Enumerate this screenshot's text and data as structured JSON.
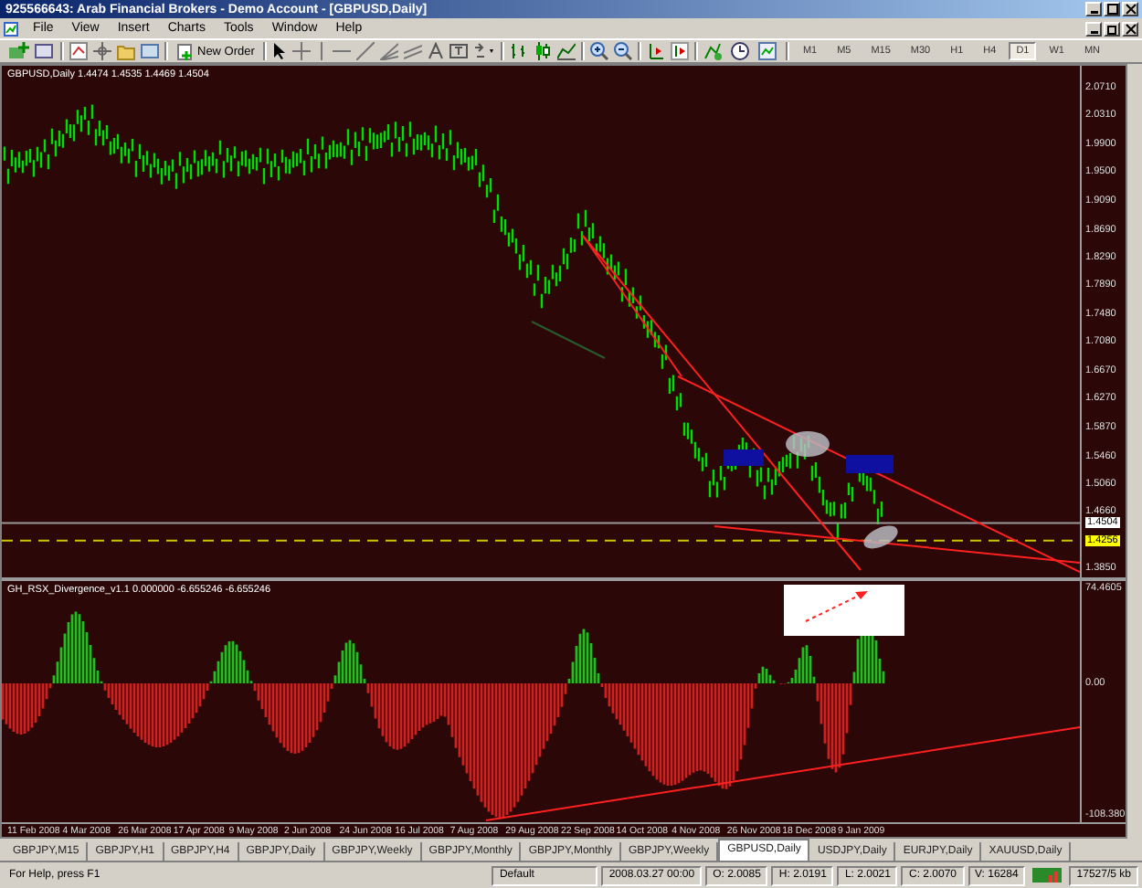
{
  "window": {
    "title": "925566643: Arab Financial Brokers - Demo Account - [GBPUSD,Daily]"
  },
  "menu": [
    "File",
    "View",
    "Insert",
    "Charts",
    "Tools",
    "Window",
    "Help"
  ],
  "toolbar": {
    "new_order": "New Order",
    "timeframes": [
      {
        "label": "M1",
        "selected": false
      },
      {
        "label": "M5",
        "selected": false
      },
      {
        "label": "M15",
        "selected": false
      },
      {
        "label": "M30",
        "selected": false
      },
      {
        "label": "H1",
        "selected": false
      },
      {
        "label": "H4",
        "selected": false
      },
      {
        "label": "D1",
        "selected": true
      },
      {
        "label": "W1",
        "selected": false
      },
      {
        "label": "MN",
        "selected": false
      }
    ]
  },
  "chart": {
    "header": "GBPUSD,Daily  1.4474 1.4535 1.4469 1.4504",
    "price_axis": [
      "2.0710",
      "2.0310",
      "1.9900",
      "1.9500",
      "1.9090",
      "1.8690",
      "1.8290",
      "1.7890",
      "1.7480",
      "1.7080",
      "1.6670",
      "1.6270",
      "1.5870",
      "1.5460",
      "1.5060",
      "1.4660",
      "1.3850"
    ],
    "bid_label": "1.4504",
    "ask_label": "1.4256"
  },
  "indicator": {
    "header": "GH_RSX_Divergence_v1.1 0.000000 -6.655246 -6.655246",
    "axis": [
      "74.4605",
      "0.00",
      "-108.380"
    ]
  },
  "time_axis": [
    "11 Feb 2008",
    "4 Mar 2008",
    "26 Mar 2008",
    "17 Apr 2008",
    "9 May 2008",
    "2 Jun 2008",
    "24 Jun 2008",
    "16 Jul 2008",
    "7 Aug 2008",
    "29 Aug 2008",
    "22 Sep 2008",
    "14 Oct 2008",
    "4 Nov 2008",
    "26 Nov 2008",
    "18 Dec 2008",
    "9 Jan 2009"
  ],
  "tabs": [
    {
      "label": "GBPJPY,M15",
      "selected": false
    },
    {
      "label": "GBPJPY,H1",
      "selected": false
    },
    {
      "label": "GBPJPY,H4",
      "selected": false
    },
    {
      "label": "GBPJPY,Daily",
      "selected": false
    },
    {
      "label": "GBPJPY,Weekly",
      "selected": false
    },
    {
      "label": "GBPJPY,Monthly",
      "selected": false
    },
    {
      "label": "GBPJPY,Monthly",
      "selected": false
    },
    {
      "label": "GBPJPY,Weekly",
      "selected": false
    },
    {
      "label": "GBPUSD,Daily",
      "selected": true
    },
    {
      "label": "USDJPY,Daily",
      "selected": false
    },
    {
      "label": "EURJPY,Daily",
      "selected": false
    },
    {
      "label": "XAUUSD,Daily",
      "selected": false
    }
  ],
  "status_bar": {
    "help": "For Help, press F1",
    "profile": "Default",
    "time": "2008.03.27 00:00",
    "open": "O: 2.0085",
    "high": "H: 2.0191",
    "low": "L: 2.0021",
    "close": "C: 2.0070",
    "volume": "V: 16284",
    "traffic": "17527/5 kb"
  }
}
